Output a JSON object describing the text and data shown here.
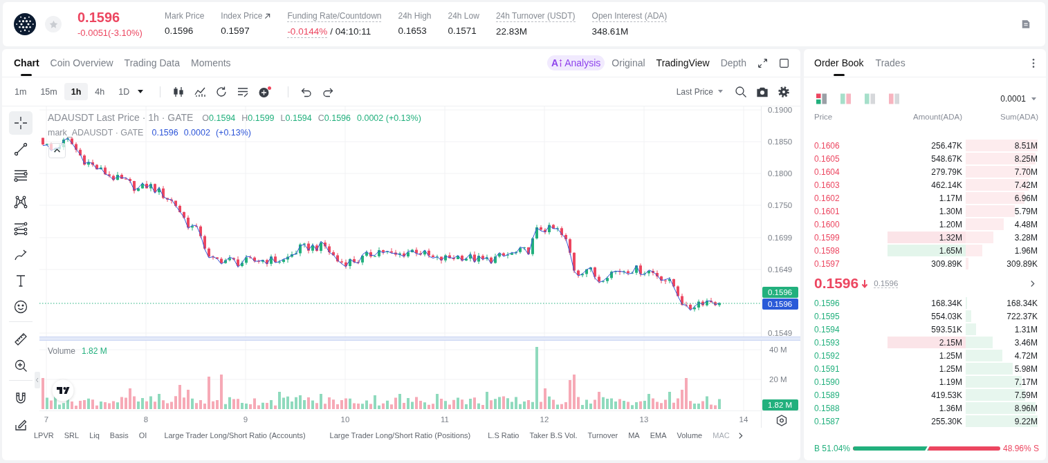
{
  "header": {
    "price": "0.1596",
    "change": "-0.0051(-3.10%)",
    "falling": true,
    "favorited": false,
    "stats": [
      {
        "label": "Mark Price",
        "value": "0.1596",
        "kind": "plain"
      },
      {
        "label": "Index Price",
        "value": "0.1597",
        "kind": "link"
      },
      {
        "label": "Funding Rate/Countdown",
        "value": "-0.0144%",
        "extra": "/ 04:10:11",
        "kind": "funding",
        "negative": true
      },
      {
        "label": "24h High",
        "value": "0.1653",
        "kind": "plain"
      },
      {
        "label": "24h Low",
        "value": "0.1571",
        "kind": "plain"
      },
      {
        "label": "24h Turnover (USDT)",
        "value": "22.83M",
        "kind": "hint"
      },
      {
        "label": "Open Interest (ADA)",
        "value": "348.61M",
        "kind": "hint"
      }
    ]
  },
  "chart_panel": {
    "tabs": [
      {
        "label": "Chart",
        "selected": true
      },
      {
        "label": "Coin Overview",
        "selected": false
      },
      {
        "label": "Trading Data",
        "selected": false
      },
      {
        "label": "Moments",
        "selected": false
      }
    ],
    "views": [
      {
        "label": "Analysis",
        "prefix": "A",
        "kind": "ai",
        "selected": false
      },
      {
        "label": "Original",
        "kind": "plain",
        "selected": false
      },
      {
        "label": "TradingView",
        "kind": "plain",
        "selected": true
      },
      {
        "label": "Depth",
        "kind": "plain",
        "selected": false
      }
    ],
    "intervals": [
      {
        "label": "1m",
        "selected": false
      },
      {
        "label": "15m",
        "selected": false
      },
      {
        "label": "1h",
        "selected": true
      },
      {
        "label": "4h",
        "selected": false
      },
      {
        "label": "1D",
        "selected": false
      }
    ],
    "price_source": "Last Price",
    "drawing_tools": [
      {
        "selected": true
      },
      {
        "selected": false
      },
      {
        "selected": false
      },
      {
        "selected": false
      },
      {
        "selected": false
      },
      {
        "selected": false
      },
      {
        "selected": false
      },
      {
        "selected": false
      },
      {
        "selected": false
      },
      {
        "selected": false
      },
      {
        "selected": false
      },
      {
        "selected": false
      }
    ],
    "legend": {
      "title": "ADAUSDT Last Price · 1h · GATE",
      "rising": true,
      "ohlc": [
        {
          "key": "O",
          "value": "0.1594"
        },
        {
          "key": "H",
          "value": "0.1599"
        },
        {
          "key": "L",
          "value": "0.1594"
        },
        {
          "key": "C",
          "value": "0.1596"
        }
      ],
      "change": "0.0002 (+0.13%)"
    },
    "mark_legend": {
      "title": "mark_ADAUSDT · GATE",
      "values": [
        "0.1596",
        "0.0002",
        "(+0.13%)"
      ]
    },
    "price_axis": [
      "0.1900",
      "0.1850",
      "0.1800",
      "0.1750",
      "0.1699",
      "0.1649",
      "0.1549"
    ],
    "price_tags": [
      {
        "value": "0.1596",
        "color": "#22b07d"
      },
      {
        "value": "0.1596",
        "color": "#2a5ad8"
      }
    ],
    "volume": {
      "label": "Volume",
      "value": "1.82 M",
      "axis": [
        "40 M",
        "20 M"
      ],
      "tag": "1.82 M"
    },
    "time_axis": [
      "7",
      "8",
      "9",
      "10",
      "11",
      "12",
      "13",
      "14"
    ],
    "indicators": [
      "LPVR",
      "SRL",
      "Liq",
      "Basis",
      "OI",
      "Large Trader Long/Short Ratio (Accounts)",
      "Large Trader Long/Short Ratio (Positions)",
      "L.S Ratio",
      "Taker B.S Vol.",
      "Turnover",
      "MA",
      "EMA",
      "Volume",
      "MAC"
    ]
  },
  "order_book": {
    "tabs": [
      {
        "label": "Order Book",
        "selected": true
      },
      {
        "label": "Trades",
        "selected": false
      }
    ],
    "layouts": [
      {
        "selected": true
      },
      {
        "selected": false
      },
      {
        "selected": false
      },
      {
        "selected": false
      }
    ],
    "precision": "0.0001",
    "columns": [
      "Price",
      "Amount(ADA)",
      "Sum(ADA)"
    ],
    "asks": [
      {
        "price": "0.1606",
        "amount": "256.47K",
        "sum": "8.51M",
        "flash": false
      },
      {
        "price": "0.1605",
        "amount": "548.67K",
        "sum": "8.25M",
        "flash": false
      },
      {
        "price": "0.1604",
        "amount": "279.79K",
        "sum": "7.70M",
        "flash": false
      },
      {
        "price": "0.1603",
        "amount": "462.14K",
        "sum": "7.42M",
        "flash": false
      },
      {
        "price": "0.1602",
        "amount": "1.17M",
        "sum": "6.96M",
        "flash": false
      },
      {
        "price": "0.1601",
        "amount": "1.30M",
        "sum": "5.79M",
        "flash": false
      },
      {
        "price": "0.1600",
        "amount": "1.20M",
        "sum": "4.48M",
        "flash": false
      },
      {
        "price": "0.1599",
        "amount": "1.32M",
        "sum": "3.28M",
        "flash": true,
        "color": "#fbe4e8"
      },
      {
        "price": "0.1598",
        "amount": "1.65M",
        "sum": "1.96M",
        "flash": true,
        "color": "#e3f5eb"
      },
      {
        "price": "0.1597",
        "amount": "309.89K",
        "sum": "309.89K",
        "flash": false
      }
    ],
    "mid": {
      "price": "0.1596",
      "falling": true,
      "mark": "0.1596"
    },
    "bids": [
      {
        "price": "0.1596",
        "amount": "168.34K",
        "sum": "168.34K",
        "flash": false
      },
      {
        "price": "0.1595",
        "amount": "554.03K",
        "sum": "722.37K",
        "flash": false
      },
      {
        "price": "0.1594",
        "amount": "593.51K",
        "sum": "1.31M",
        "flash": false
      },
      {
        "price": "0.1593",
        "amount": "2.15M",
        "sum": "3.46M",
        "flash": true,
        "color": "#fbe4e8"
      },
      {
        "price": "0.1592",
        "amount": "1.25M",
        "sum": "4.72M",
        "flash": false
      },
      {
        "price": "0.1591",
        "amount": "1.25M",
        "sum": "5.98M",
        "flash": false
      },
      {
        "price": "0.1590",
        "amount": "1.19M",
        "sum": "7.17M",
        "flash": false
      },
      {
        "price": "0.1589",
        "amount": "419.53K",
        "sum": "7.59M",
        "flash": false
      },
      {
        "price": "0.1588",
        "amount": "1.36M",
        "sum": "8.96M",
        "flash": false
      },
      {
        "price": "0.1587",
        "amount": "255.30K",
        "sum": "9.22M",
        "flash": false
      }
    ],
    "ratio": {
      "buy": "B 51.04%",
      "sell": "48.96% S",
      "level": 0.5104
    }
  }
}
